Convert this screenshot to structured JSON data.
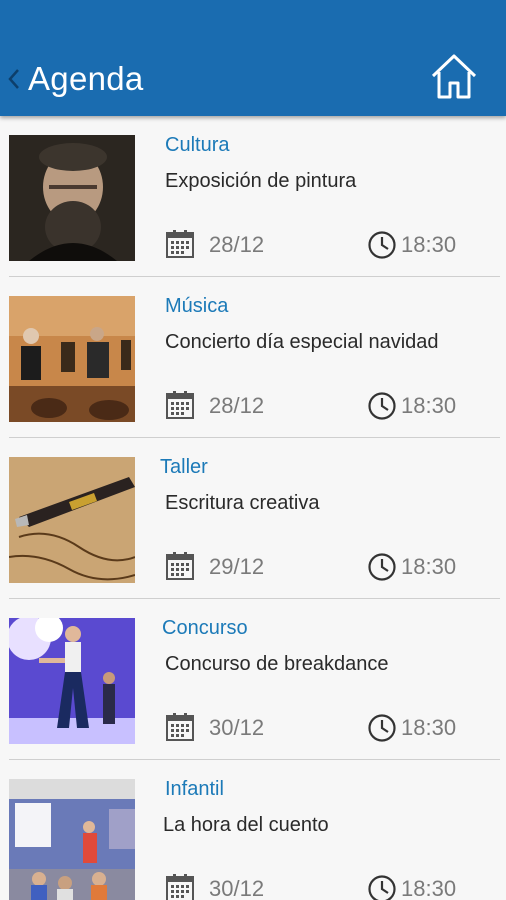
{
  "header": {
    "title": "Agenda",
    "back_icon": "chevron-left-icon",
    "home_icon": "home-icon",
    "bar_color": "#1a6cb0"
  },
  "events": [
    {
      "category": "Cultura",
      "name": "Exposición de pintura",
      "date": "28/12",
      "time": "18:30",
      "image": "portrait-painting"
    },
    {
      "category": "Música",
      "name": "Concierto día especial navidad",
      "date": "28/12",
      "time": "18:30",
      "image": "string-quartet"
    },
    {
      "category": "Taller",
      "name": "Escritura creativa",
      "date": "29/12",
      "time": "18:30",
      "image": "fountain-pen"
    },
    {
      "category": "Concurso",
      "name": "Concurso de breakdance",
      "date": "30/12",
      "time": "18:30",
      "image": "dancers"
    },
    {
      "category": "Infantil",
      "name": "La hora del cuento",
      "date": "30/12",
      "time": "18:30",
      "image": "children-room"
    }
  ]
}
